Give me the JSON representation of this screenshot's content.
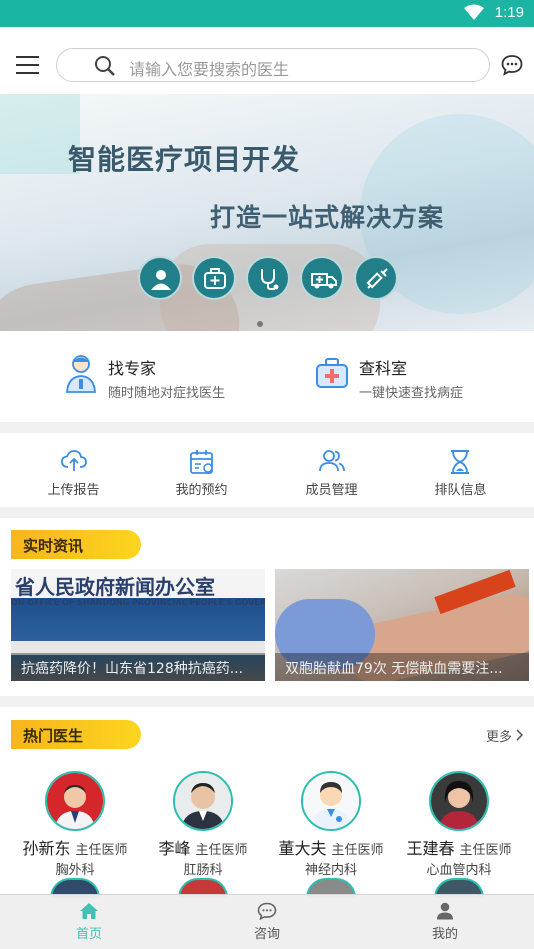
{
  "status_bar": {
    "time": "1:19"
  },
  "search": {
    "placeholder": "请输入您要搜索的医生"
  },
  "banner": {
    "title": "智能医疗项目开发",
    "subtitle": "打造一站式解决方案",
    "icons": [
      "doctor-icon",
      "first-aid-kit-icon",
      "stethoscope-icon",
      "ambulance-icon",
      "syringe-icon"
    ]
  },
  "quick_links": [
    {
      "title": "找专家",
      "desc": "随时随地对症找医生",
      "icon": "expert-doctor-icon"
    },
    {
      "title": "查科室",
      "desc": "一键快速查找病症",
      "icon": "medical-kit-icon"
    }
  ],
  "functions": [
    {
      "label": "上传报告",
      "icon": "cloud-upload-icon"
    },
    {
      "label": "我的预约",
      "icon": "calendar-icon"
    },
    {
      "label": "成员管理",
      "icon": "users-icon"
    },
    {
      "label": "排队信息",
      "icon": "hourglass-icon"
    }
  ],
  "news": {
    "section_title": "实时资讯",
    "items": [
      {
        "caption": "抗癌药降价！山东省128种抗癌药...",
        "photo_banner": "省人民政府新闻办公室",
        "photo_banner_sub": "ON OFFICE OF SHANDONG PROVINCIAL PEOPLE'S GOVERNMENT"
      },
      {
        "caption": "双胞胎献血79次 无偿献血需要注..."
      }
    ]
  },
  "doctors": {
    "section_title": "热门医生",
    "more_label": "更多",
    "items": [
      {
        "name": "孙新东",
        "title": "主任医师",
        "dept": "胸外科"
      },
      {
        "name": "李峰",
        "title": "主任医师",
        "dept": "肛肠科"
      },
      {
        "name": "董大夫",
        "title": "主任医师",
        "dept": "神经内科"
      },
      {
        "name": "王建春",
        "title": "主任医师",
        "dept": "心血管内科"
      }
    ]
  },
  "bottom_nav": [
    {
      "label": "首页",
      "icon": "home-icon",
      "active": true
    },
    {
      "label": "咨询",
      "icon": "chat-icon",
      "active": false
    },
    {
      "label": "我的",
      "icon": "user-icon",
      "active": false
    }
  ],
  "colors": {
    "accent": "#1cb5a4",
    "nav_active": "#3fc2b5",
    "tag_yellow": "#f9c51d",
    "icon_blue": "#3a8ee6"
  }
}
